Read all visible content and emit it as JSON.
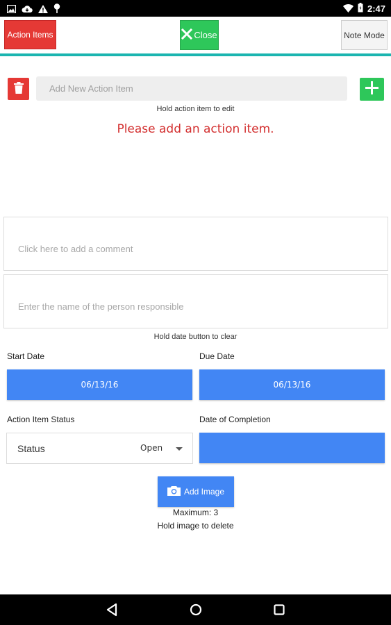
{
  "status_bar": {
    "time": "2:47",
    "left_icons": [
      "image-icon",
      "cloud-icon",
      "warning-icon",
      "pin-icon"
    ],
    "right_icons": [
      "wifi-icon",
      "battery-icon"
    ]
  },
  "toolbar": {
    "action_items_label": "Action Items",
    "close_label": "Close",
    "note_mode_label": "Note Mode",
    "accent_line_color": "#1bb5b0"
  },
  "new_item": {
    "placeholder": "Add New Action Item",
    "hint": "Hold action item to edit"
  },
  "list": {
    "empty_message": "Please add an action item."
  },
  "comment": {
    "placeholder": "Click here to add a comment"
  },
  "responsible": {
    "placeholder": "Enter the name of the person responsible"
  },
  "dates": {
    "hint": "Hold date button to clear",
    "start_label": "Start Date",
    "start_value": "06/13/16",
    "due_label": "Due Date",
    "due_value": "06/13/16",
    "completion_label": "Date of Completion",
    "completion_value": ""
  },
  "status": {
    "section_label": "Action Item Status",
    "field_label": "Status",
    "selected_value": "Open"
  },
  "images": {
    "add_label": "Add Image",
    "maximum_text": "Maximum: 3",
    "hint": "Hold image to delete"
  },
  "colors": {
    "red": "#e53935",
    "green": "#2ec75a",
    "blue": "#4286f4",
    "error_text": "#d32f2f"
  }
}
